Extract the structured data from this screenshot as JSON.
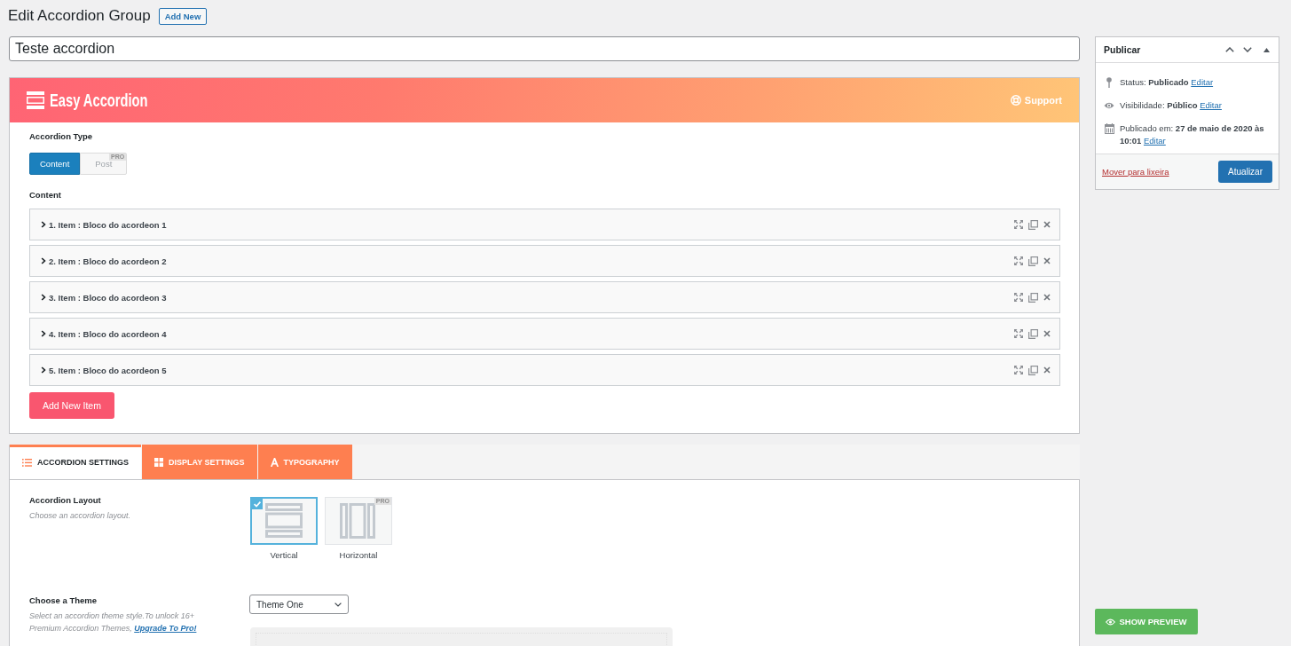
{
  "page": {
    "title": "Edit Accordion Group",
    "add_new": "Add New"
  },
  "title_field": {
    "value": "Teste accordion"
  },
  "banner": {
    "brand": "Easy Accordion",
    "support": "Support"
  },
  "accordion_type": {
    "label": "Accordion Type",
    "options": [
      {
        "label": "Content",
        "selected": true
      },
      {
        "label": "Post",
        "selected": false,
        "badge": "PRO"
      }
    ]
  },
  "content": {
    "label": "Content",
    "items": [
      {
        "title": "1. Item : Bloco do acordeon 1",
        "expanded": false
      },
      {
        "title": "2. Item : Bloco do acordeon 2",
        "expanded": false
      },
      {
        "title": "3. Item : Bloco do acordeon 3",
        "expanded": false
      },
      {
        "title": "4. Item : Bloco do acordeon 4",
        "expanded": false
      },
      {
        "title": "5. Item : Bloco do acordeon 5",
        "expanded": false
      }
    ],
    "add_button": "Add New Item"
  },
  "settings_tabs": [
    {
      "label": "ACCORDION SETTINGS",
      "selected": true
    },
    {
      "label": "DISPLAY SETTINGS",
      "selected": false
    },
    {
      "label": "TYPOGRAPHY",
      "selected": false
    }
  ],
  "layout_field": {
    "label": "Accordion Layout",
    "description": "Choose an accordion layout.",
    "options": [
      {
        "label": "Vertical",
        "selected": true
      },
      {
        "label": "Horizontal",
        "selected": false,
        "badge": "PRO"
      }
    ]
  },
  "theme_field": {
    "label": "Choose a Theme",
    "description": "Select an accordion theme style.To unlock 16+ Premium Accordion Themes,",
    "link": "Upgrade To Pro!",
    "select": {
      "value": "Theme One"
    }
  },
  "publish": {
    "title": "Publicar",
    "rows": [
      {
        "text": "Status: **Publicado**",
        "link": "Editar"
      },
      {
        "text": "Visibilidade: **Público**",
        "link": "Editar"
      },
      {
        "text": "Publicado em: **27 de maio de 2020 às 10:01**",
        "link": "Editar"
      }
    ],
    "trash": "Mover para lixeira",
    "update": "Atualizar"
  },
  "preview_button": "SHOW PREVIEW"
}
